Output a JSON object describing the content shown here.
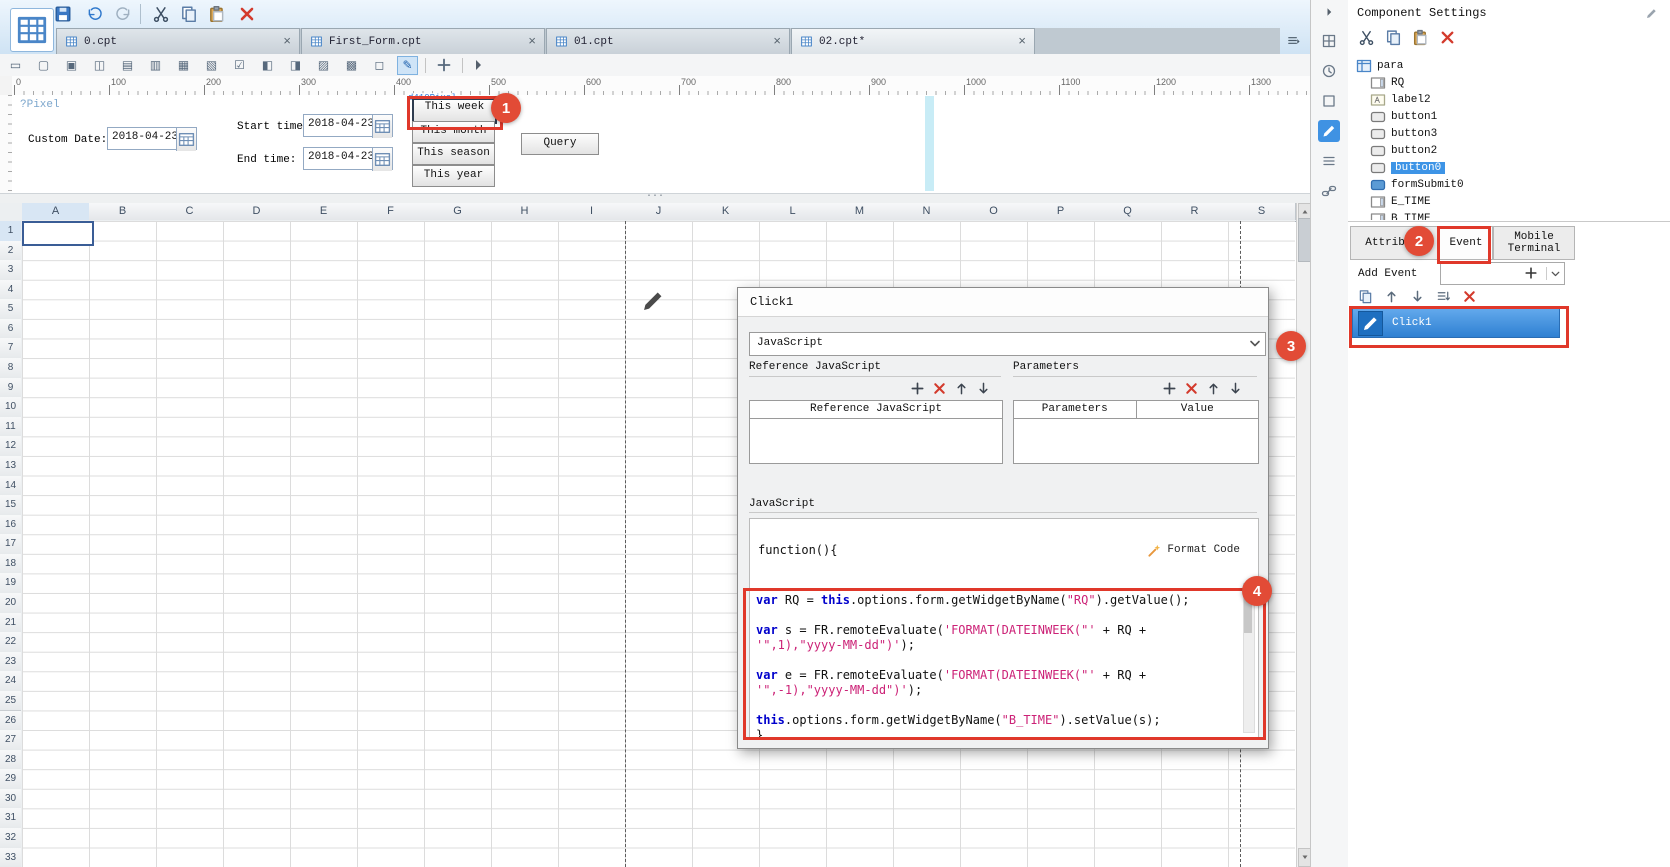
{
  "colors": {
    "annotation_red": "#e0382a",
    "selection_blue": "#3d94e6",
    "toolbar_blue": "#d9e9f8",
    "code_keyword_blue": "#0000cc",
    "code_string_pink": "#cc2277",
    "event_bar_blue": "#2f80d2",
    "guide_cyan": "#c8ecf6"
  },
  "main_toolbar": [
    {
      "name": "app-icon",
      "glyph": "gridtab",
      "big": true
    },
    {
      "name": "save-icon",
      "glyph": "floppy"
    },
    {
      "name": "undo-icon",
      "glyph": "undo"
    },
    {
      "name": "redo-icon",
      "glyph": "redo"
    },
    {
      "name": "cut-icon",
      "glyph": "scissors"
    },
    {
      "name": "copy-icon",
      "glyph": "copy"
    },
    {
      "name": "paste-icon",
      "glyph": "paste"
    },
    {
      "name": "delete-icon",
      "glyph": "x",
      "red": true
    }
  ],
  "tabs": [
    {
      "label": "0.cpt",
      "active": false
    },
    {
      "label": "First_Form.cpt",
      "active": false
    },
    {
      "label": "01.cpt",
      "active": false
    },
    {
      "label": "02.cpt*",
      "active": true
    }
  ],
  "widget_toolbar_icons": [
    {
      "name": "select-pointer-icon",
      "glyph": "▭"
    },
    {
      "name": "text-editor-icon",
      "glyph": "▢"
    },
    {
      "name": "textarea-icon",
      "glyph": "▣"
    },
    {
      "name": "number-editor-icon",
      "glyph": "◫"
    },
    {
      "name": "password-editor-icon",
      "glyph": "▤"
    },
    {
      "name": "combobox-icon",
      "glyph": "▥"
    },
    {
      "name": "combocheck-icon",
      "glyph": "▦"
    },
    {
      "name": "date-editor-icon",
      "glyph": "▧"
    },
    {
      "name": "checkbox-icon",
      "glyph": "☑"
    },
    {
      "name": "radio-group-icon",
      "glyph": "◧"
    },
    {
      "name": "checkbox-group-icon",
      "glyph": "◨"
    },
    {
      "name": "tree-editor-icon",
      "glyph": "▨"
    },
    {
      "name": "view-tree-icon",
      "glyph": "▩"
    },
    {
      "name": "file-editor-icon",
      "glyph": "◻"
    },
    {
      "name": "style-brush-icon",
      "glyph": "✎",
      "selected": true
    }
  ],
  "ruler": {
    "unit_start": 0,
    "unit_step": 100,
    "label_count": 14
  },
  "form_area": {
    "pane_tag": "?Pixel",
    "widget_tag": "d410Pixel",
    "fields": [
      {
        "name": "custom-date",
        "label": "Custom Date:",
        "value": "2018-04-23"
      },
      {
        "name": "start-time",
        "label": "Start time:",
        "value": "2018-04-23"
      },
      {
        "name": "end-time",
        "label": "End time:",
        "value": "2018-04-23"
      }
    ],
    "quick_buttons": [
      {
        "label": "This week",
        "selected": true
      },
      {
        "label": "This month",
        "selected": false
      },
      {
        "label": "This season",
        "selected": false
      },
      {
        "label": "This year",
        "selected": false
      }
    ],
    "query_button": "Query",
    "splitter_dots": "···"
  },
  "grid": {
    "columns": [
      "A",
      "B",
      "C",
      "D",
      "E",
      "F",
      "G",
      "H",
      "I",
      "J",
      "K",
      "L",
      "M",
      "N",
      "O",
      "P",
      "Q",
      "R",
      "S"
    ],
    "row_count": 33,
    "selected_cell": "A1"
  },
  "dock_strip": [
    {
      "name": "component-list-icon",
      "glyph": "grid4",
      "selected": false
    },
    {
      "name": "history-icon",
      "glyph": "clock",
      "selected": false
    },
    {
      "name": "body-settings-icon",
      "glyph": "square",
      "selected": false
    },
    {
      "name": "widget-settings-icon",
      "glyph": "pencil",
      "selected": true
    },
    {
      "name": "attribute-list-icon",
      "glyph": "list",
      "selected": false
    },
    {
      "name": "hyperlink-icon",
      "glyph": "link",
      "selected": false
    }
  ],
  "right_panel": {
    "title": "Component Settings",
    "component_toolbar": [
      {
        "name": "cut-component-icon",
        "glyph": "scissors",
        "red": false
      },
      {
        "name": "copy-component-icon",
        "glyph": "copy",
        "red": false
      },
      {
        "name": "paste-component-icon",
        "glyph": "paste",
        "red": false
      },
      {
        "name": "delete-component-icon",
        "glyph": "x",
        "red": true
      }
    ],
    "tree": [
      {
        "label": "para",
        "icon": "pane",
        "level": 0,
        "selected": false
      },
      {
        "label": "RQ",
        "icon": "date",
        "level": 1,
        "selected": false
      },
      {
        "label": "label2",
        "icon": "label",
        "level": 1,
        "selected": false
      },
      {
        "label": "button1",
        "icon": "button",
        "level": 1,
        "selected": false
      },
      {
        "label": "button3",
        "icon": "button",
        "level": 1,
        "selected": false
      },
      {
        "label": "button2",
        "icon": "button",
        "level": 1,
        "selected": false
      },
      {
        "label": "button0",
        "icon": "button",
        "level": 1,
        "selected": true
      },
      {
        "label": "formSubmit0",
        "icon": "submit",
        "level": 1,
        "selected": false
      },
      {
        "label": "E_TIME",
        "icon": "date",
        "level": 1,
        "selected": false
      },
      {
        "label": "B_TIME",
        "icon": "date",
        "level": 1,
        "selected": false
      }
    ],
    "tabs": [
      {
        "label": "Attribute",
        "active": false
      },
      {
        "label": "Event",
        "active": true
      },
      {
        "label": "Mobile Terminal",
        "active": false
      }
    ],
    "add_event_label": "Add Event",
    "event_toolbar": [
      {
        "name": "copy-event-icon",
        "glyph": "copy",
        "red": false
      },
      {
        "name": "move-event-up-icon",
        "glyph": "up",
        "red": false
      },
      {
        "name": "move-event-down-icon",
        "glyph": "down",
        "red": false
      },
      {
        "name": "sort-events-icon",
        "glyph": "sort",
        "red": false
      },
      {
        "name": "delete-event-icon",
        "glyph": "x",
        "red": true
      }
    ],
    "events": [
      {
        "label": "Click1",
        "selected": true
      }
    ]
  },
  "dialog": {
    "title": "Click1",
    "language": "JavaScript",
    "reference_label": "Reference JavaScript",
    "parameters_label": "Parameters",
    "table_headers": {
      "reference": "Reference JavaScript",
      "parameters": "Parameters",
      "value": "Value"
    },
    "js_label": "JavaScript",
    "function_open": "function(){",
    "format_code_label": "Format Code",
    "toolbar": [
      {
        "name": "add",
        "glyph": "plus",
        "red": false
      },
      {
        "name": "delete",
        "glyph": "x",
        "red": true
      },
      {
        "name": "move-up",
        "glyph": "up",
        "red": false
      },
      {
        "name": "move-down",
        "glyph": "down",
        "red": false
      }
    ],
    "code_lines": [
      "var RQ = this.options.form.getWidgetByName(\"RQ\").getValue();",
      "",
      "var s = FR.remoteEvaluate('FORMAT(DATEINWEEK(\"' + RQ +",
      "'\",1),\"yyyy-MM-dd\")');",
      "",
      "var e = FR.remoteEvaluate('FORMAT(DATEINWEEK(\"' + RQ +",
      "'\",-1),\"yyyy-MM-dd\")');",
      "",
      "this.options.form.getWidgetByName(\"B_TIME\").setValue(s);"
    ],
    "closing_brace": "}"
  },
  "annotations": [
    {
      "number": "1"
    },
    {
      "number": "2"
    },
    {
      "number": "3"
    },
    {
      "number": "4"
    }
  ]
}
